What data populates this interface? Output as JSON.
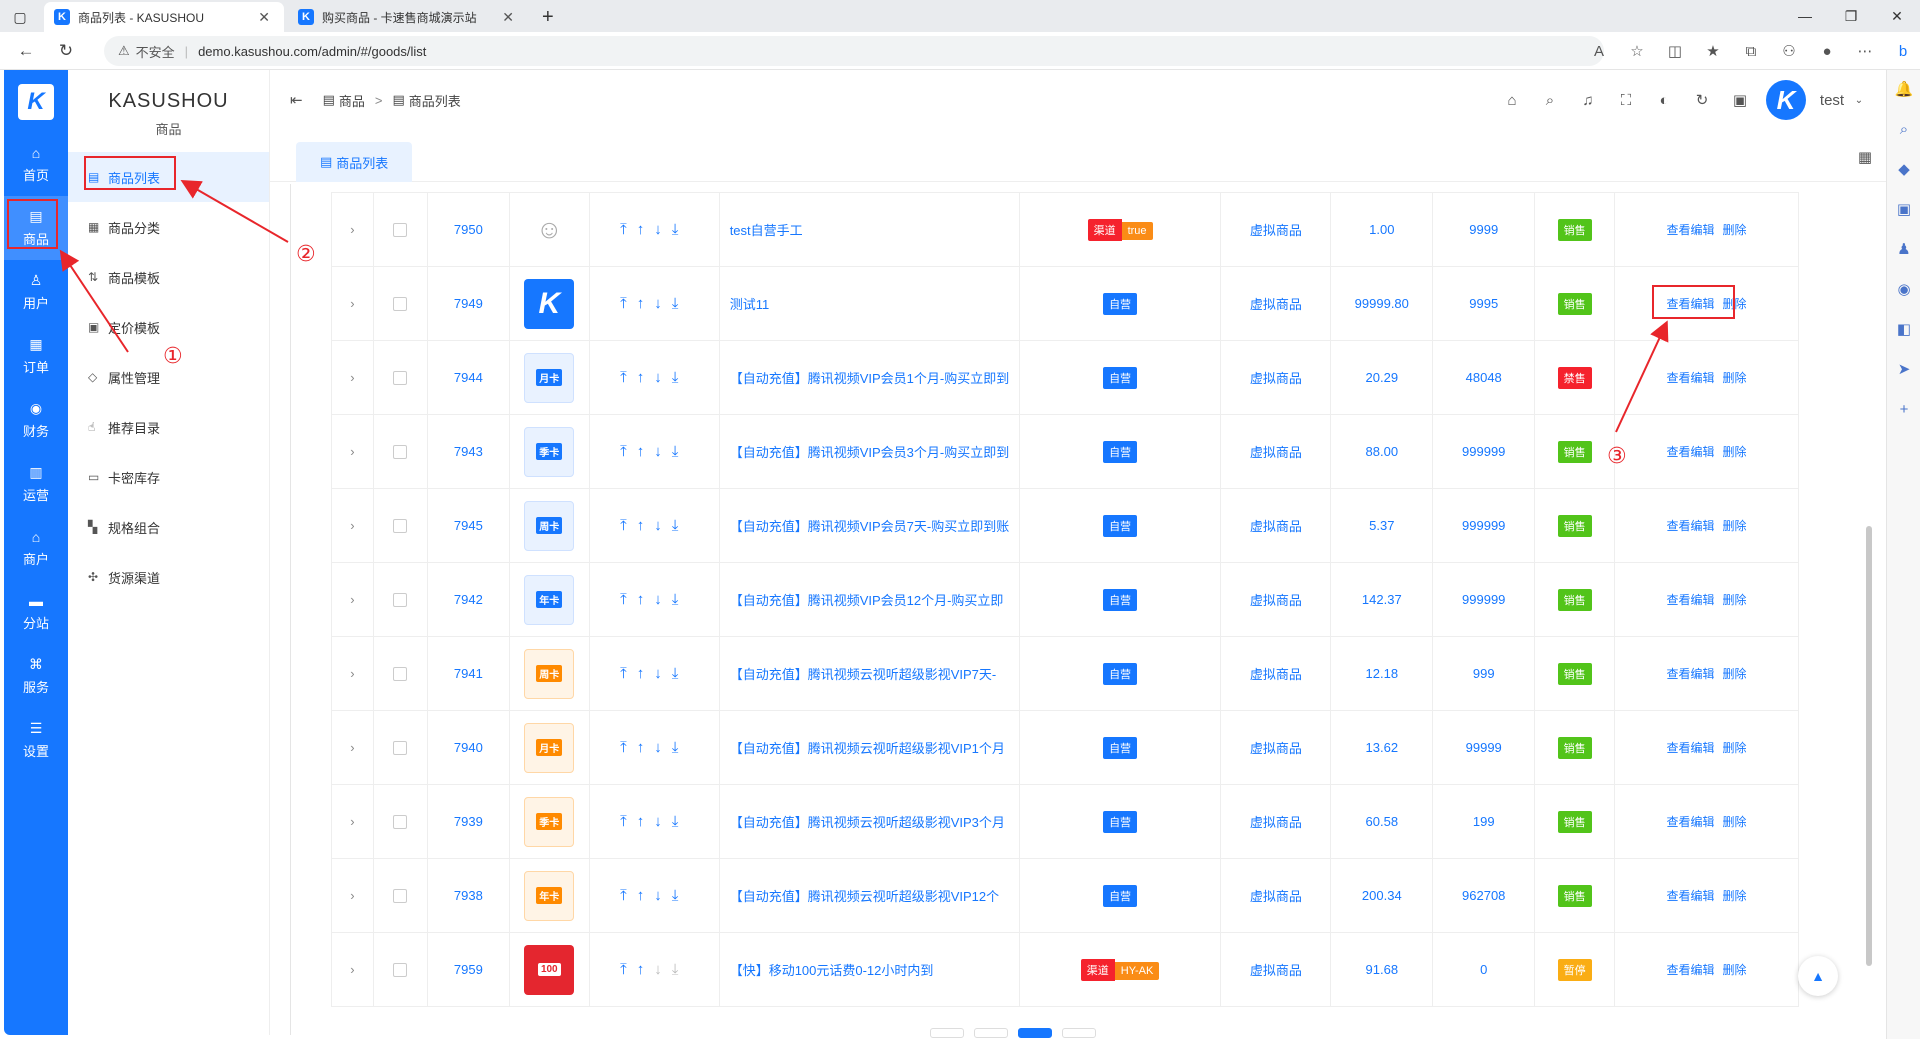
{
  "browser": {
    "tabs": [
      {
        "title": "商品列表 - KASUSHOU",
        "active": true
      },
      {
        "title": "购买商品 - 卡速售商城演示站",
        "active": false
      }
    ],
    "insecure_label": "不安全",
    "url": "demo.kasushou.com/admin/#/goods/list"
  },
  "left_nav": {
    "logo": "K",
    "items": [
      {
        "label": "首页",
        "icon": "home-icon"
      },
      {
        "label": "商品",
        "icon": "goods-icon",
        "active": true
      },
      {
        "label": "用户",
        "icon": "user-icon"
      },
      {
        "label": "订单",
        "icon": "order-icon"
      },
      {
        "label": "财务",
        "icon": "finance-icon"
      },
      {
        "label": "运营",
        "icon": "operate-icon"
      },
      {
        "label": "商户",
        "icon": "merchant-icon"
      },
      {
        "label": "分站",
        "icon": "substation-icon"
      },
      {
        "label": "服务",
        "icon": "service-icon"
      },
      {
        "label": "设置",
        "icon": "settings-icon"
      }
    ]
  },
  "submenu": {
    "brand": "KASUSHOU",
    "section": "商品",
    "items": [
      {
        "label": "商品列表",
        "active": true
      },
      {
        "label": "商品分类"
      },
      {
        "label": "商品模板"
      },
      {
        "label": "定价模板"
      },
      {
        "label": "属性管理"
      },
      {
        "label": "推荐目录"
      },
      {
        "label": "卡密库存"
      },
      {
        "label": "规格组合"
      },
      {
        "label": "货源渠道"
      }
    ]
  },
  "header": {
    "breadcrumb": [
      "商品",
      "商品列表"
    ],
    "username": "test"
  },
  "page_tab": "商品列表",
  "annotations": [
    "①",
    "②",
    "③"
  ],
  "rows": [
    {
      "id": "7950",
      "img": "sketch",
      "name": "test自营手工",
      "type": [
        "渠道",
        "true"
      ],
      "goods_type": "虚拟商品",
      "price": "1.00",
      "stock": "9999",
      "status": "销售",
      "status_color": "green",
      "ops": [
        "查看编辑",
        "删除"
      ]
    },
    {
      "id": "7949",
      "img": "k",
      "name": "测试11",
      "type": [
        "自营"
      ],
      "goods_type": "虚拟商品",
      "price": "99999.80",
      "stock": "9995",
      "status": "销售",
      "status_color": "green",
      "ops": [
        "查看编辑",
        "删除"
      ]
    },
    {
      "id": "7944",
      "img": "blue",
      "img_label": "月卡",
      "name": "【自动充值】腾讯视频VIP会员1个月-购买立即到",
      "type": [
        "自营"
      ],
      "goods_type": "虚拟商品",
      "price": "20.29",
      "stock": "48048",
      "status": "禁售",
      "status_color": "red",
      "ops": [
        "查看编辑",
        "删除"
      ]
    },
    {
      "id": "7943",
      "img": "blue",
      "img_label": "季卡",
      "name": "【自动充值】腾讯视频VIP会员3个月-购买立即到",
      "type": [
        "自营"
      ],
      "goods_type": "虚拟商品",
      "price": "88.00",
      "stock": "999999",
      "status": "销售",
      "status_color": "green",
      "ops": [
        "查看编辑",
        "删除"
      ]
    },
    {
      "id": "7945",
      "img": "blue",
      "img_label": "周卡",
      "name": "【自动充值】腾讯视频VIP会员7天-购买立即到账",
      "type": [
        "自营"
      ],
      "goods_type": "虚拟商品",
      "price": "5.37",
      "stock": "999999",
      "status": "销售",
      "status_color": "green",
      "ops": [
        "查看编辑",
        "删除"
      ]
    },
    {
      "id": "7942",
      "img": "blue",
      "img_label": "年卡",
      "name": "【自动充值】腾讯视频VIP会员12个月-购买立即",
      "type": [
        "自营"
      ],
      "goods_type": "虚拟商品",
      "price": "142.37",
      "stock": "999999",
      "status": "销售",
      "status_color": "green",
      "ops": [
        "查看编辑",
        "删除"
      ]
    },
    {
      "id": "7941",
      "img": "orange",
      "img_label": "周卡",
      "name": "【自动充值】腾讯视频云视听超级影视VIP7天-",
      "type": [
        "自营"
      ],
      "goods_type": "虚拟商品",
      "price": "12.18",
      "stock": "999",
      "status": "销售",
      "status_color": "green",
      "ops": [
        "查看编辑",
        "删除"
      ]
    },
    {
      "id": "7940",
      "img": "orange",
      "img_label": "月卡",
      "name": "【自动充值】腾讯视频云视听超级影视VIP1个月",
      "type": [
        "自营"
      ],
      "goods_type": "虚拟商品",
      "price": "13.62",
      "stock": "99999",
      "status": "销售",
      "status_color": "green",
      "ops": [
        "查看编辑",
        "删除"
      ]
    },
    {
      "id": "7939",
      "img": "orange",
      "img_label": "季卡",
      "name": "【自动充值】腾讯视频云视听超级影视VIP3个月",
      "type": [
        "自营"
      ],
      "goods_type": "虚拟商品",
      "price": "60.58",
      "stock": "199",
      "status": "销售",
      "status_color": "green",
      "ops": [
        "查看编辑",
        "删除"
      ]
    },
    {
      "id": "7938",
      "img": "orange",
      "img_label": "年卡",
      "name": "【自动充值】腾讯视频云视听超级影视VIP12个",
      "type": [
        "自营"
      ],
      "goods_type": "虚拟商品",
      "price": "200.34",
      "stock": "962708",
      "status": "销售",
      "status_color": "green",
      "ops": [
        "查看编辑",
        "删除"
      ]
    },
    {
      "id": "7959",
      "img": "red",
      "img_label": "100",
      "name": "【快】移动100元话费0-12小时内到",
      "type": [
        "渠道",
        "HY-AK"
      ],
      "goods_type": "虚拟商品",
      "price": "91.68",
      "stock": "0",
      "status": "暂停",
      "status_color": "orange",
      "sort_partial": true,
      "ops": [
        "查看编辑",
        "删除"
      ]
    }
  ]
}
